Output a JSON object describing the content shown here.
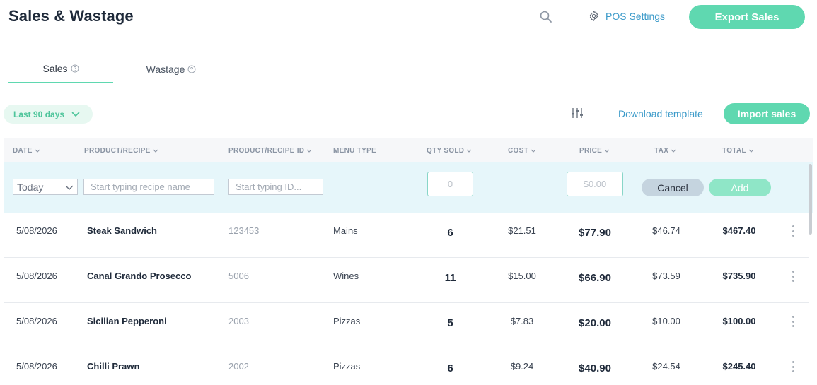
{
  "header": {
    "title": "Sales & Wastage",
    "pos_settings_label": "POS Settings",
    "export_label": "Export Sales"
  },
  "tabs": [
    {
      "label": "Sales",
      "active": true
    },
    {
      "label": "Wastage",
      "active": false
    }
  ],
  "toolbar": {
    "date_filter": "Last 90 days",
    "download_label": "Download template",
    "import_label": "Import sales"
  },
  "columns": {
    "date": "DATE",
    "product": "PRODUCT/RECIPE",
    "product_id": "PRODUCT/RECIPE ID",
    "menu_type": "MENU TYPE",
    "qty_sold": "QTY SOLD",
    "cost": "COST",
    "price": "PRICE",
    "tax": "TAX",
    "total": "TOTAL"
  },
  "add_row": {
    "date_value": "Today",
    "recipe_placeholder": "Start typing recipe name",
    "id_placeholder": "Start typing ID...",
    "qty_placeholder": "0",
    "price_placeholder": "$0.00",
    "cancel_label": "Cancel",
    "add_label": "Add"
  },
  "rows": [
    {
      "date": "5/08/2026",
      "product": "Steak Sandwich",
      "id": "123453",
      "menu_type": "Mains",
      "qty": "6",
      "cost": "$21.51",
      "price": "$77.90",
      "tax": "$46.74",
      "total": "$467.40"
    },
    {
      "date": "5/08/2026",
      "product": "Canal Grando Prosecco",
      "id": "5006",
      "menu_type": "Wines",
      "qty": "11",
      "cost": "$15.00",
      "price": "$66.90",
      "tax": "$73.59",
      "total": "$735.90"
    },
    {
      "date": "5/08/2026",
      "product": "Sicilian Pepperoni",
      "id": "2003",
      "menu_type": "Pizzas",
      "qty": "5",
      "cost": "$7.83",
      "price": "$20.00",
      "tax": "$10.00",
      "total": "$100.00"
    },
    {
      "date": "5/08/2026",
      "product": "Chilli Prawn",
      "id": "2002",
      "menu_type": "Pizzas",
      "qty": "6",
      "cost": "$9.24",
      "price": "$40.90",
      "tax": "$24.54",
      "total": "$245.40"
    }
  ],
  "colors": {
    "accent_green": "#5fd8b0",
    "link_blue": "#3b9ac9",
    "add_row_bg": "#e6f6fa"
  },
  "icons": {
    "search": "search-icon",
    "settings": "gear-icon",
    "help": "help-circle-icon",
    "chevron": "chevron-down-icon",
    "filter": "sliders-icon",
    "row_menu": "kebab-menu-icon"
  }
}
